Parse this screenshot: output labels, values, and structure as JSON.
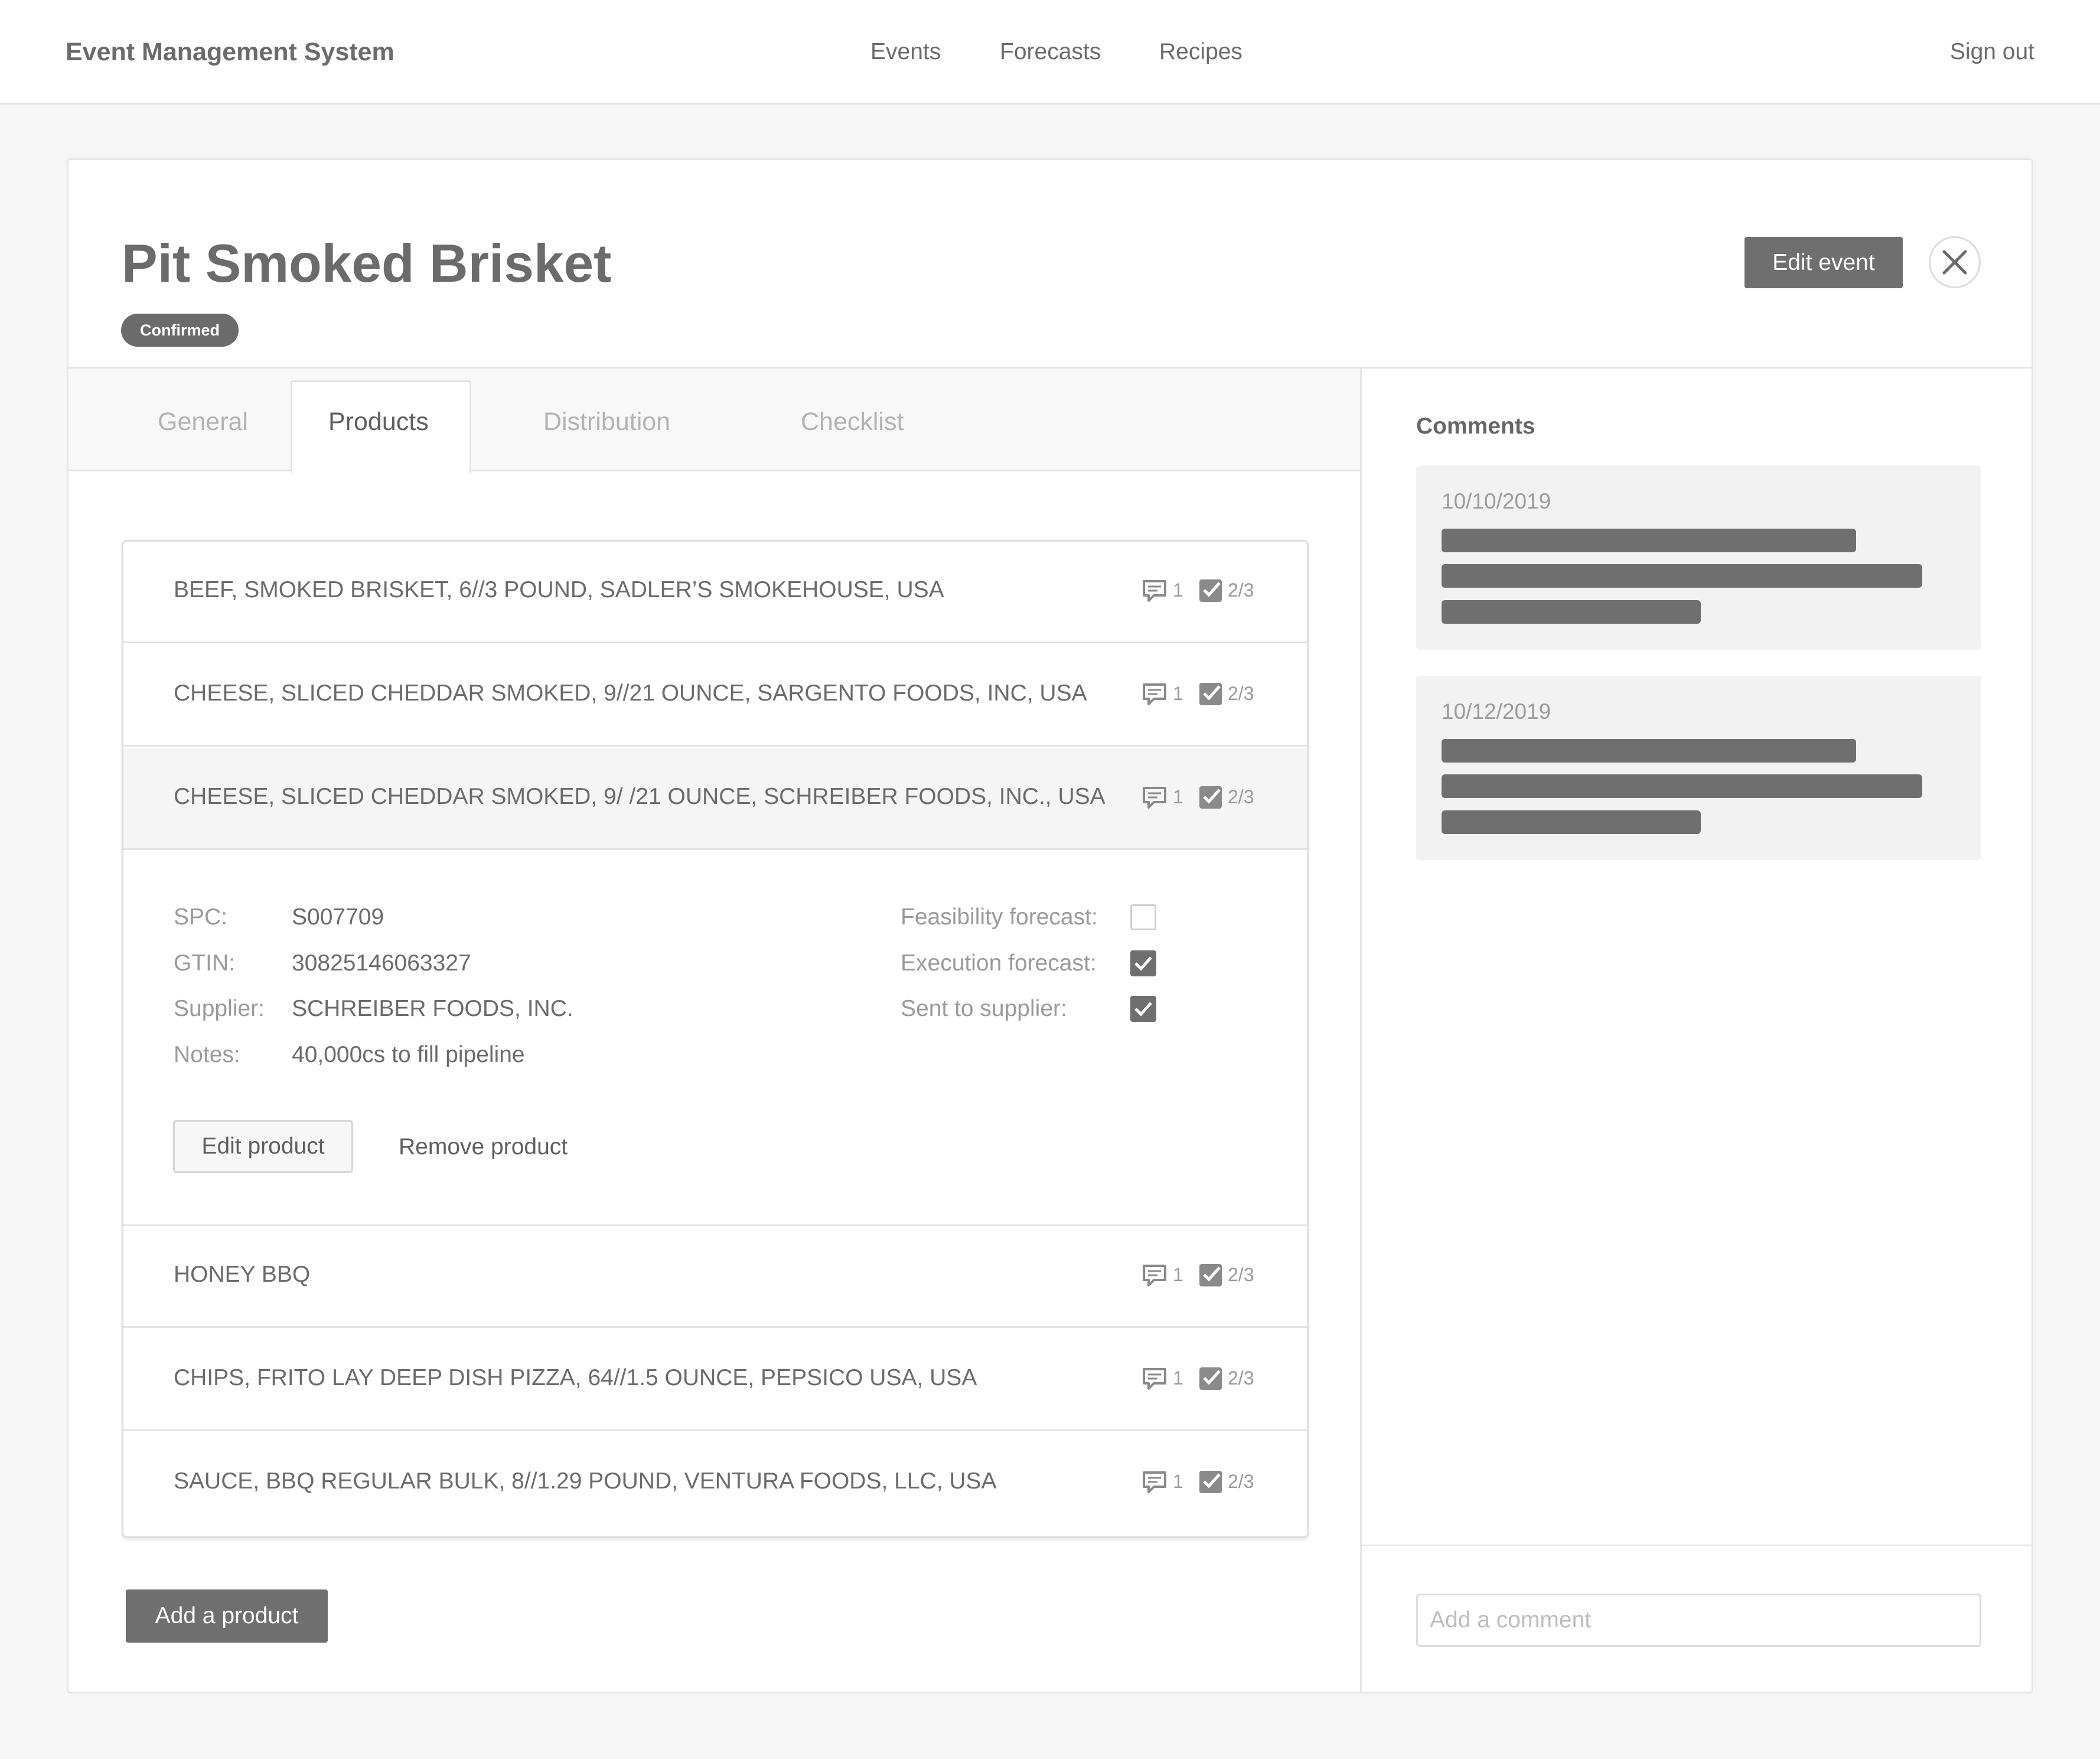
{
  "app": {
    "brand": "Event Management System",
    "nav": [
      "Events",
      "Forecasts",
      "Recipes"
    ],
    "sign_out": "Sign out"
  },
  "event": {
    "title": "Pit Smoked Brisket",
    "status": "Confirmed",
    "edit_label": "Edit event",
    "close_icon": "close-icon"
  },
  "tabs": [
    {
      "label": "General",
      "active": false
    },
    {
      "label": "Products",
      "active": true
    },
    {
      "label": "Distribution",
      "active": false
    },
    {
      "label": "Checklist",
      "active": false
    }
  ],
  "products": [
    {
      "name": "BEEF, SMOKED BRISKET, 6//3 POUND, SADLER’S SMOKEHOUSE, USA",
      "comments": "1",
      "checks": "2/3"
    },
    {
      "name": "CHEESE, SLICED CHEDDAR SMOKED, 9//21 OUNCE, SARGENTO FOODS, INC, USA",
      "comments": "1",
      "checks": "2/3"
    },
    {
      "name": "CHEESE, SLICED CHEDDAR SMOKED, 9/ /21 OUNCE, SCHREIBER FOODS, INC., USA",
      "comments": "1",
      "checks": "2/3"
    },
    {
      "name": "HONEY BBQ",
      "comments": "1",
      "checks": "2/3"
    },
    {
      "name": "CHIPS, FRITO LAY DEEP DISH PIZZA, 64//1.5 OUNCE, PEPSICO USA, USA",
      "comments": "1",
      "checks": "2/3"
    },
    {
      "name": "SAUCE, BBQ REGULAR BULK, 8//1.29 POUND, VENTURA FOODS, LLC, USA",
      "comments": "1",
      "checks": "2/3"
    }
  ],
  "selected_product": {
    "fields": [
      {
        "label": "SPC:",
        "value": "S007709"
      },
      {
        "label": "GTIN:",
        "value": "30825146063327"
      },
      {
        "label": "Supplier:",
        "value": "SCHREIBER FOODS, INC."
      },
      {
        "label": "Notes:",
        "value": "40,000cs to fill pipeline"
      }
    ],
    "flags": [
      {
        "label": "Feasibility forecast:",
        "checked": false
      },
      {
        "label": "Execution forecast:",
        "checked": true
      },
      {
        "label": "Sent to supplier:",
        "checked": true
      }
    ],
    "edit_label": "Edit product",
    "remove_label": "Remove product"
  },
  "add_product_label": "Add a product",
  "comments": {
    "title": "Comments",
    "items": [
      {
        "date": "10/10/2019"
      },
      {
        "date": "10/12/2019"
      }
    ],
    "input_placeholder": "Add a comment"
  },
  "colors": {
    "accent": "#6f6f6f",
    "background": "#f5f6f5",
    "card": "#ffffff"
  }
}
